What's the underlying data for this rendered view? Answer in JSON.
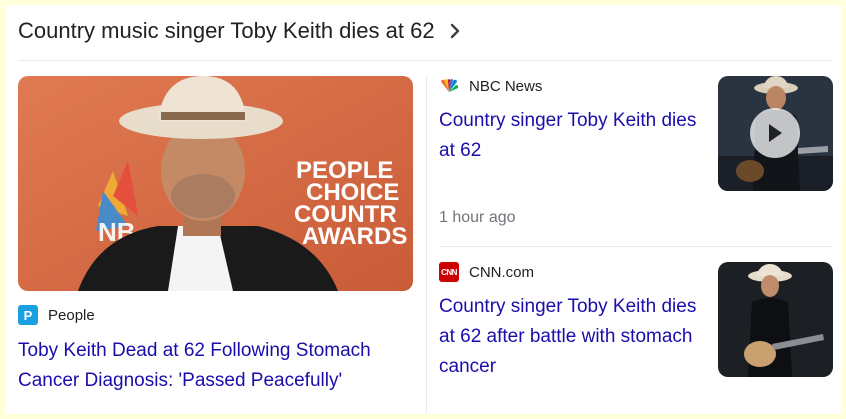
{
  "header": {
    "title": "Country music singer Toby Keith dies at 62",
    "chevron_icon": "chevron-right-icon"
  },
  "main_story": {
    "source": "People",
    "source_logo_letter": "P",
    "source_logo_color": "#1a9fe0",
    "headline": "Toby Keith Dead at 62 Following Stomach Cancer Diagnosis: 'Passed Peacefully'",
    "image_backdrop_text": [
      "PEOPLE",
      "CHOICE",
      "COUNTR",
      "AWARDS"
    ]
  },
  "stories": [
    {
      "source": "NBC News",
      "source_logo": "nbc-peacock-icon",
      "headline": "Country singer Toby Keith dies at 62",
      "time": "1 hour ago",
      "has_video": true
    },
    {
      "source": "CNN.com",
      "source_logo_letter": "CNN",
      "source_logo_color": "#cc0000",
      "headline": "Country singer Toby Keith dies at 62 after battle with stomach cancer",
      "has_video": false
    }
  ],
  "colors": {
    "link": "#1a0dab",
    "text": "#202124",
    "meta": "#70757a",
    "page_bg": "#ffffd9"
  }
}
